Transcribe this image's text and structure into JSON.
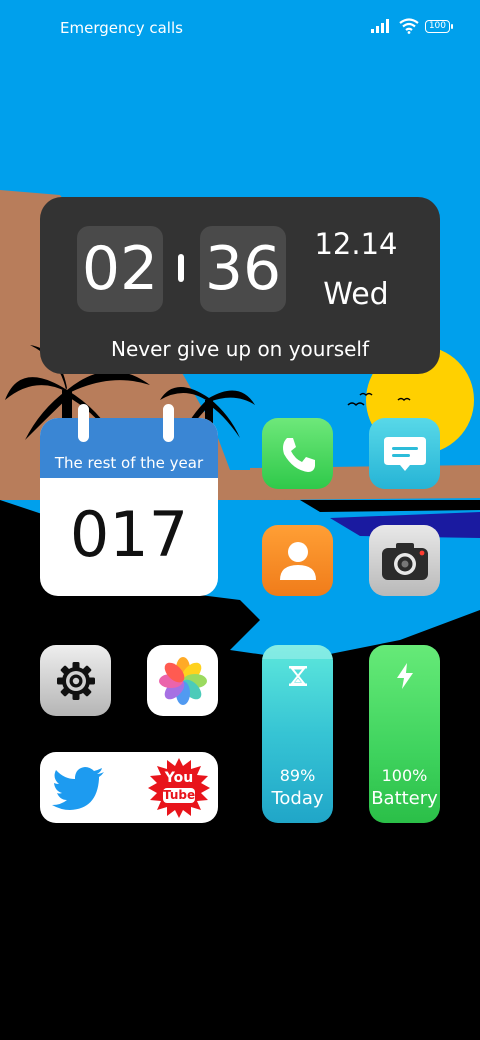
{
  "status_bar": {
    "left_text": "Emergency calls",
    "battery": "100",
    "icons": [
      "signal-icon",
      "wifi-icon",
      "battery-icon"
    ]
  },
  "clock_widget": {
    "hour": "02",
    "minute": "36",
    "date": "12.14",
    "weekday": "Wed",
    "motto": "Never give up on yourself"
  },
  "calendar_widget": {
    "title": "The rest of the year",
    "days": "017"
  },
  "apps": [
    {
      "name": "Phone",
      "icon": "phone-icon",
      "color": "#4cd964"
    },
    {
      "name": "Messages",
      "icon": "message-icon",
      "color": "#3cc8e0"
    },
    {
      "name": "Contacts",
      "icon": "contact-icon",
      "color": "#f08a24"
    },
    {
      "name": "Camera",
      "icon": "camera-icon",
      "color": "#d4d4d4"
    },
    {
      "name": "Settings",
      "icon": "gear-icon",
      "color": "#d4d4d4"
    },
    {
      "name": "Photos",
      "icon": "photos-icon",
      "color": "#ffffff"
    }
  ],
  "social_widget": {
    "twitter_icon": "twitter-icon",
    "youtube_icon": "youtube-icon",
    "youtube_top": "You",
    "youtube_bottom": "Tube"
  },
  "screen_time_widget": {
    "percent": "89%",
    "label": "Today",
    "icon": "hourglass-icon",
    "colors": [
      "#4fe3d6",
      "#24a7c9"
    ]
  },
  "battery_widget": {
    "percent": "100%",
    "label": "Battery",
    "icon": "lightning-icon",
    "colors": [
      "#5ee86f",
      "#2fc24b"
    ]
  },
  "colors": {
    "sky": "#00a0ec",
    "sun": "#ffd000",
    "sand": "#b87d5b"
  }
}
